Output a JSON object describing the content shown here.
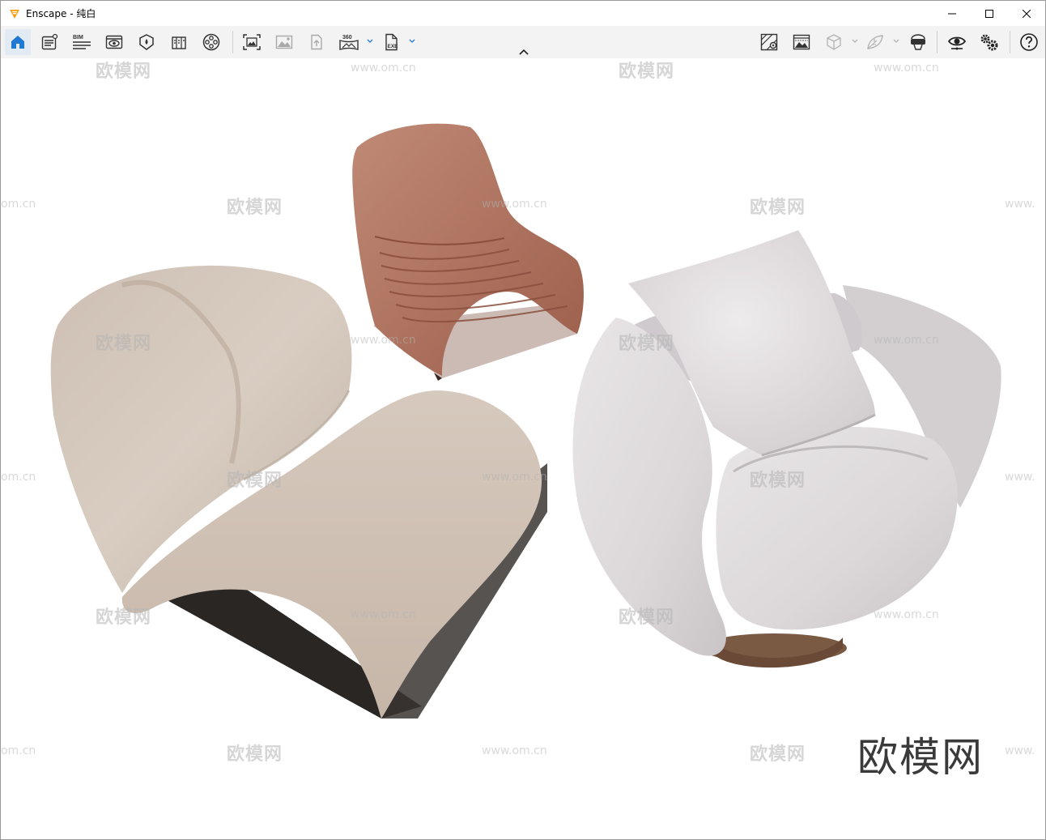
{
  "window": {
    "title": "Enscape - 纯白",
    "brand_color": "#f7a11a"
  },
  "toolbar": {
    "left_tools": [
      {
        "icon": "home-icon",
        "active": true
      },
      {
        "icon": "visual-settings-icon"
      },
      {
        "icon": "bim-icon",
        "label": "BIM"
      },
      {
        "icon": "views-icon"
      },
      {
        "icon": "materials-icon"
      },
      {
        "icon": "asset-library-icon"
      },
      {
        "icon": "video-editor-icon"
      },
      {
        "icon": "screenshot-icon"
      },
      {
        "icon": "gallery-icon"
      },
      {
        "icon": "upload-icon"
      },
      {
        "icon": "panorama-360-icon",
        "label": "360"
      },
      {
        "icon": "export-exe-icon",
        "label": "EXE"
      }
    ],
    "right_tools": [
      {
        "icon": "site-context-icon"
      },
      {
        "icon": "atmosphere-icon"
      },
      {
        "icon": "section-cube-icon"
      },
      {
        "icon": "leaf-icon"
      },
      {
        "icon": "vr-headset-icon"
      },
      {
        "icon": "eye-icon"
      },
      {
        "icon": "settings-icon"
      },
      {
        "icon": "help-icon"
      }
    ]
  },
  "viewport": {
    "watermark_text": "欧模网",
    "watermark_url": "www.om.cn",
    "watermark_partial_url": "om.cn",
    "watermark_partial_url_right": "www.",
    "corner_logo_text": "欧模网"
  }
}
